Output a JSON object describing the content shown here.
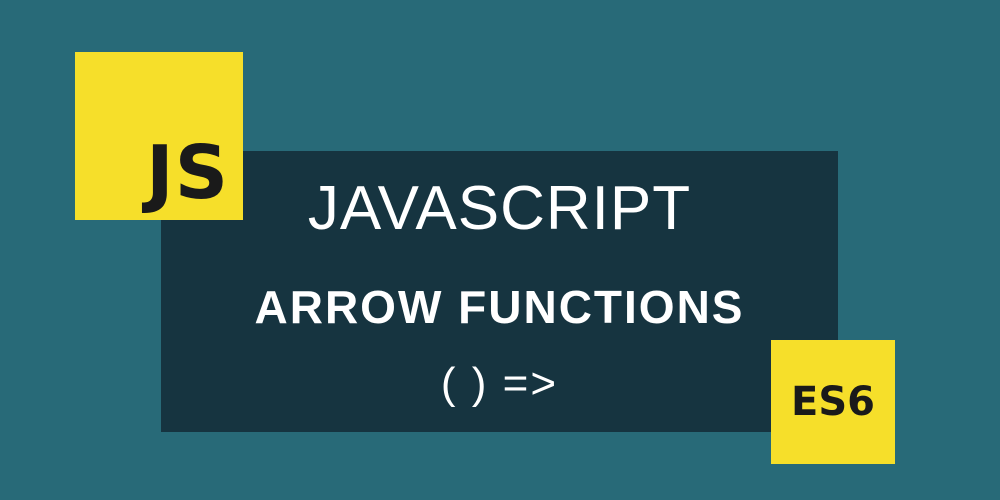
{
  "badges": {
    "js": "JS",
    "es": "ES6"
  },
  "panel": {
    "title": "JAVASCRIPT",
    "subtitle": "ARROW FUNCTIONS",
    "syntax": "( ) =>"
  },
  "colors": {
    "background": "#286a78",
    "panel": "#163440",
    "badge": "#f6df2a",
    "badge_text": "#1a1a1a",
    "text": "#ffffff"
  }
}
